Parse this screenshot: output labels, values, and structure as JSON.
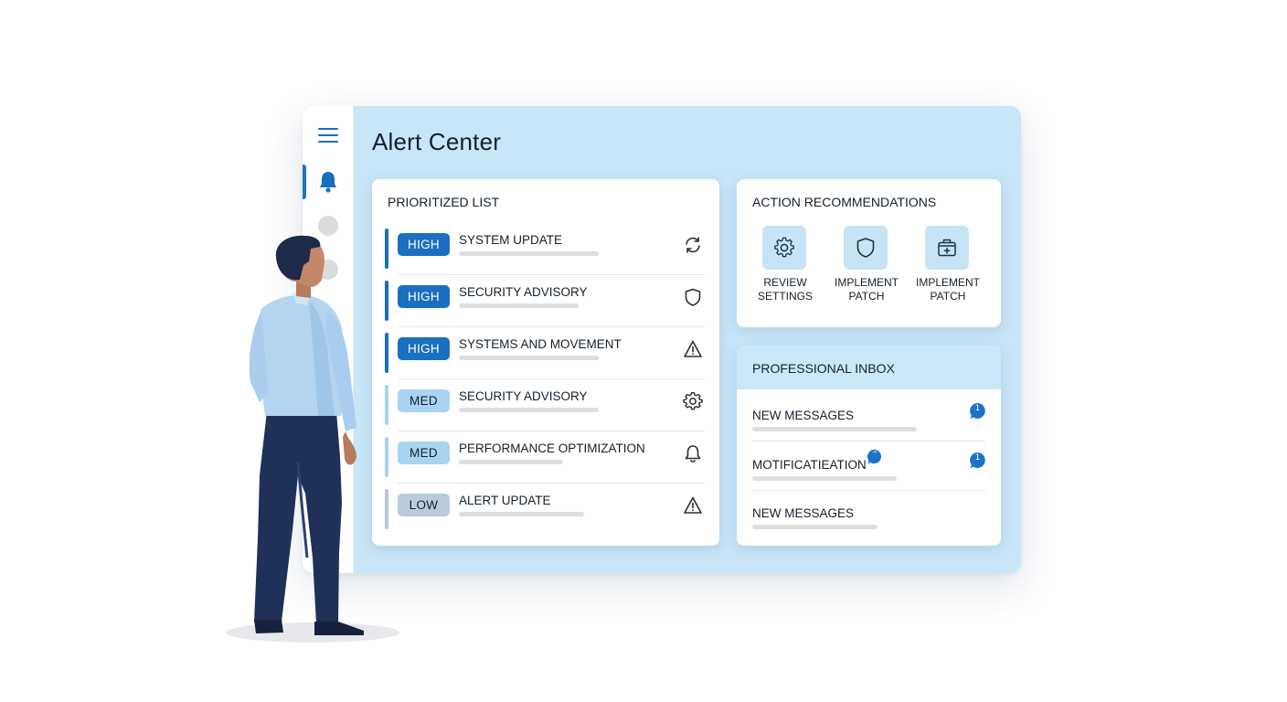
{
  "app": {
    "title": "Alert Center"
  },
  "colors": {
    "accent": "#1a6fc0",
    "panel_bg": "#c9e6f8",
    "high": "#1a6fc0",
    "med": "#a8d3f2",
    "low": "#bccbdc"
  },
  "sidebar": {
    "items": [
      {
        "icon": "menu-icon"
      },
      {
        "icon": "bell-icon",
        "active": true
      },
      {
        "icon": "placeholder-circle"
      },
      {
        "icon": "placeholder-circle"
      }
    ]
  },
  "prioritized": {
    "heading": "PRIORITIZED LIST",
    "items": [
      {
        "severity": "HIGH",
        "label": "SYSTEM UPDATE",
        "icon": "refresh-icon"
      },
      {
        "severity": "HIGH",
        "label": "SECURITY ADVISORY",
        "icon": "shield-icon"
      },
      {
        "severity": "HIGH",
        "label": "SYSTEMS AND MOVEMENT",
        "icon": "warning-icon"
      },
      {
        "severity": "MED",
        "label": "SECURITY ADVISORY",
        "icon": "gear-icon"
      },
      {
        "severity": "MED",
        "label": "PERFORMANCE OPTIMIZATION",
        "icon": "bell-icon"
      },
      {
        "severity": "LOW",
        "label": "ALERT UPDATE",
        "icon": "warning-icon"
      }
    ]
  },
  "recommendations": {
    "heading": "ACTION RECOMMENDATIONS",
    "items": [
      {
        "label": "REVIEW\nSETTINGS",
        "icon": "gear-icon"
      },
      {
        "label": "IMPLEMENT\nPATCH",
        "icon": "shield-icon"
      },
      {
        "label": "IMPLEMENT\nPATCH",
        "icon": "medical-case-icon"
      }
    ]
  },
  "inbox": {
    "heading": "PROFESSIONAL INBOX",
    "items": [
      {
        "label": "NEW MESSAGES",
        "badge": "1"
      },
      {
        "label": "MOTIFICATIEATION",
        "badge": "1",
        "inline_badge": "^"
      },
      {
        "label": "NEW MESSAGES"
      }
    ]
  }
}
